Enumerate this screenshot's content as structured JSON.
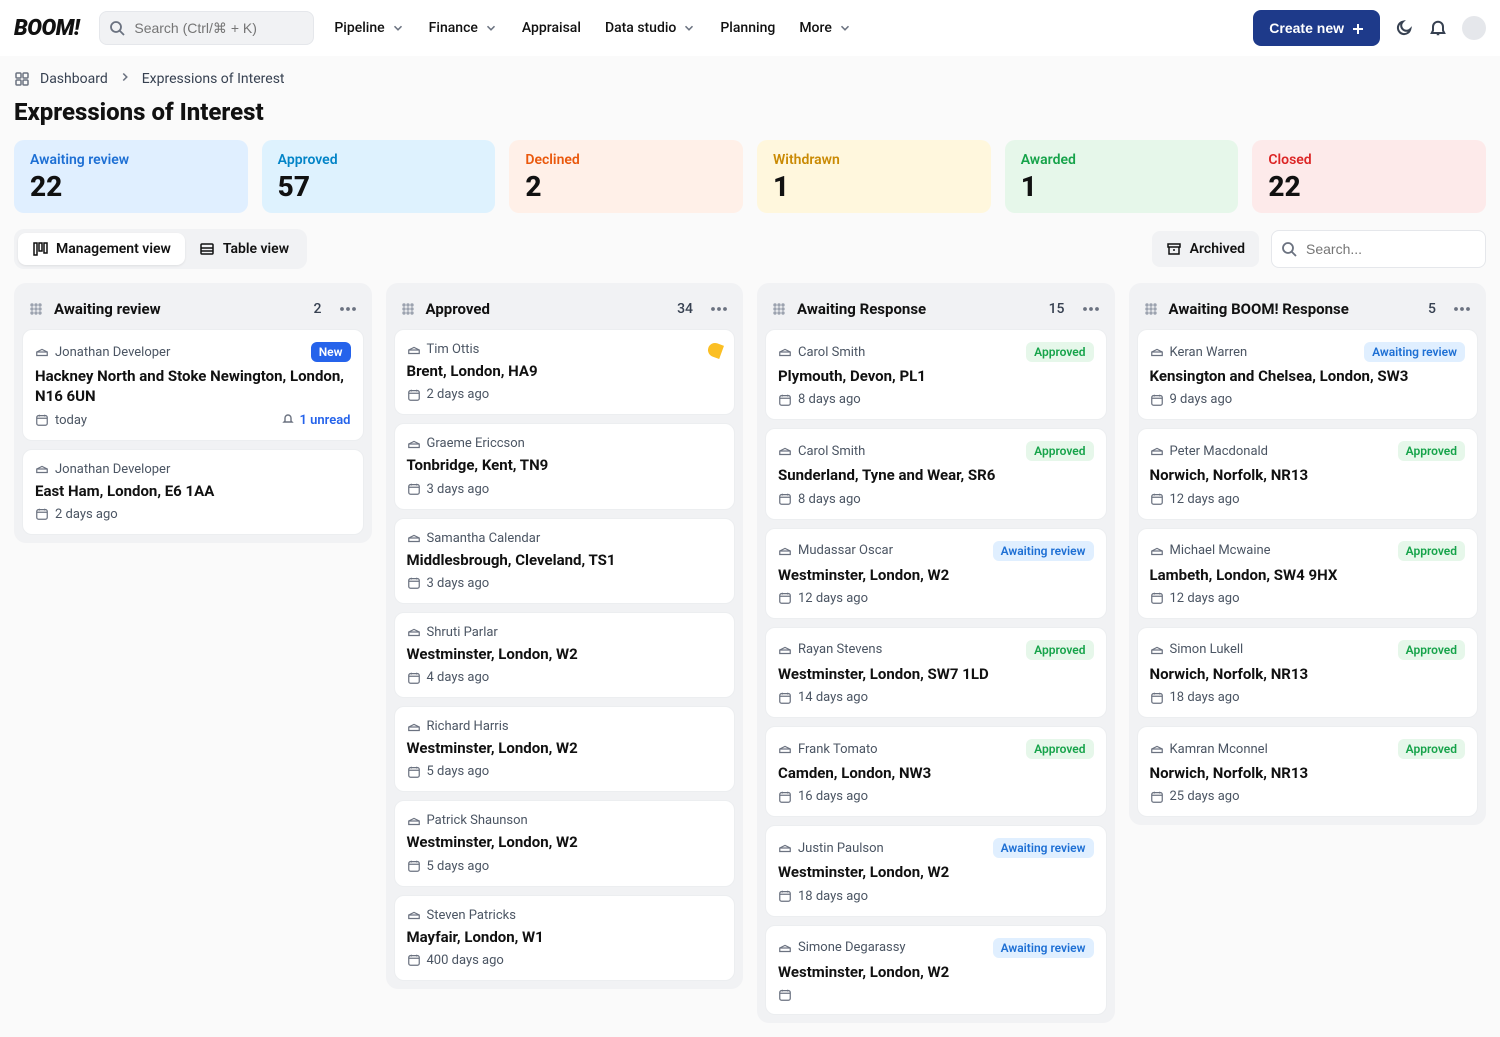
{
  "header": {
    "logo": "BOOM!",
    "search_placeholder": "Search (Ctrl/⌘ + K)",
    "nav": [
      "Pipeline",
      "Finance",
      "Appraisal",
      "Data studio",
      "Planning",
      "More"
    ],
    "nav_chevron": [
      true,
      true,
      false,
      true,
      false,
      true
    ],
    "create_label": "Create new"
  },
  "breadcrumb": {
    "root": "Dashboard",
    "page": "Expressions of Interest"
  },
  "title": "Expressions of Interest",
  "tiles": [
    {
      "label": "Awaiting review",
      "value": "22",
      "cls": "tile-awaiting"
    },
    {
      "label": "Approved",
      "value": "57",
      "cls": "tile-approved"
    },
    {
      "label": "Declined",
      "value": "2",
      "cls": "tile-declined"
    },
    {
      "label": "Withdrawn",
      "value": "1",
      "cls": "tile-withdrawn"
    },
    {
      "label": "Awarded",
      "value": "1",
      "cls": "tile-awarded"
    },
    {
      "label": "Closed",
      "value": "22",
      "cls": "tile-closed"
    }
  ],
  "toolbar": {
    "view_mgmt": "Management view",
    "view_table": "Table view",
    "archived": "Archived",
    "search_placeholder": "Search..."
  },
  "columns": [
    {
      "title": "Awaiting review",
      "count": "2",
      "cards": [
        {
          "person": "Jonathan Developer",
          "badge": "New",
          "badge_cls": "badge-new",
          "loc": "Hackney North and Stoke Newington, London, N16 6UN",
          "date": "today",
          "unread": "1 unread"
        },
        {
          "person": "Jonathan Developer",
          "loc": "East Ham, London, E6 1AA",
          "date": "2 days ago"
        }
      ]
    },
    {
      "title": "Approved",
      "count": "34",
      "cards": [
        {
          "person": "Tim Ottis",
          "moon": true,
          "loc": "Brent, London, HA9",
          "date": "2 days ago"
        },
        {
          "person": "Graeme Ericcson",
          "loc": "Tonbridge, Kent, TN9",
          "date": "3 days ago"
        },
        {
          "person": "Samantha Calendar",
          "loc": "Middlesbrough, Cleveland, TS1",
          "date": "3 days ago"
        },
        {
          "person": "Shruti Parlar",
          "loc": "Westminster, London, W2",
          "date": "4 days ago"
        },
        {
          "person": "Richard Harris",
          "loc": "Westminster, London, W2",
          "date": "5 days ago"
        },
        {
          "person": "Patrick Shaunson",
          "loc": "Westminster, London, W2",
          "date": "5 days ago"
        },
        {
          "person": "Steven Patricks",
          "loc": "Mayfair, London, W1",
          "date": "400 days ago"
        }
      ]
    },
    {
      "title": "Awaiting Response",
      "count": "15",
      "cards": [
        {
          "person": "Carol Smith",
          "badge": "Approved",
          "badge_cls": "badge-approved",
          "loc": "Plymouth, Devon, PL1",
          "date": "8 days ago"
        },
        {
          "person": "Carol Smith",
          "badge": "Approved",
          "badge_cls": "badge-approved",
          "loc": "Sunderland, Tyne and Wear, SR6",
          "date": "8 days ago"
        },
        {
          "person": "Mudassar Oscar",
          "badge": "Awaiting review",
          "badge_cls": "badge-awaiting",
          "loc": "Westminster, London, W2",
          "date": "12 days ago"
        },
        {
          "person": "Rayan Stevens",
          "badge": "Approved",
          "badge_cls": "badge-approved",
          "loc": "Westminster, London, SW7 1LD",
          "date": "14 days ago"
        },
        {
          "person": "Frank Tomato",
          "badge": "Approved",
          "badge_cls": "badge-approved",
          "loc": "Camden, London, NW3",
          "date": "16 days ago"
        },
        {
          "person": "Justin Paulson",
          "badge": "Awaiting review",
          "badge_cls": "badge-awaiting",
          "loc": "Westminster, London, W2",
          "date": "18 days ago"
        },
        {
          "person": "Simone Degarassy",
          "badge": "Awaiting review",
          "badge_cls": "badge-awaiting",
          "loc": "Westminster, London, W2",
          "date": ""
        }
      ]
    },
    {
      "title": "Awaiting BOOM! Response",
      "count": "5",
      "cards": [
        {
          "person": "Keran Warren",
          "badge": "Awaiting review",
          "badge_cls": "badge-awaiting",
          "loc": "Kensington and Chelsea, London, SW3",
          "date": "9 days ago"
        },
        {
          "person": "Peter Macdonald",
          "badge": "Approved",
          "badge_cls": "badge-approved",
          "loc": "Norwich, Norfolk, NR13",
          "date": "12 days ago"
        },
        {
          "person": "Michael Mcwaine",
          "badge": "Approved",
          "badge_cls": "badge-approved",
          "loc": "Lambeth, London, SW4 9HX",
          "date": "12 days ago"
        },
        {
          "person": "Simon Lukell",
          "badge": "Approved",
          "badge_cls": "badge-approved",
          "loc": "Norwich, Norfolk, NR13",
          "date": "18 days ago"
        },
        {
          "person": "Kamran Mconnel",
          "badge": "Approved",
          "badge_cls": "badge-approved",
          "loc": "Norwich, Norfolk, NR13",
          "date": "25 days ago"
        }
      ]
    }
  ]
}
